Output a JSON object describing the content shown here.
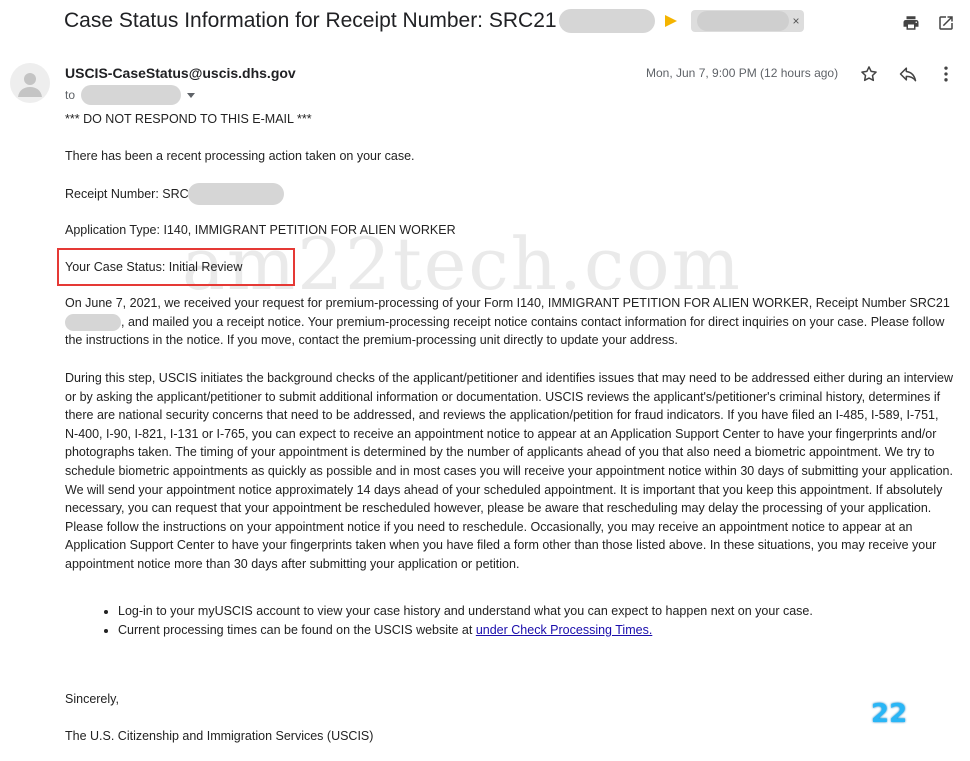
{
  "email": {
    "subject": "Case Status Information for Receipt Number: SRC21",
    "label_chip_close": "×",
    "sender": "USCIS-CaseStatus@uscis.dhs.gov",
    "to_label": "to",
    "date": "Mon, Jun 7, 9:00 PM (12 hours ago)"
  },
  "body": {
    "do_not_respond": "*** DO NOT RESPOND TO THIS E-MAIL ***",
    "recent_action": "There has been a recent processing action taken on your case.",
    "receipt_prefix": "Receipt Number: SRC",
    "application_type": "Application Type: I140, IMMIGRANT PETITION FOR ALIEN WORKER",
    "case_status": "Your Case Status: Initial Review",
    "para1_a": "On June 7, 2021, we received your request for premium-processing of your Form I140, IMMIGRANT PETITION FOR ALIEN WORKER, Receipt Number SRC21",
    "para1_b": ", and mailed you a receipt notice. Your premium-processing receipt notice contains contact information for direct inquiries on your case. Please follow the instructions in the notice. If you move, contact the premium-processing unit directly to update your address.",
    "para2": "During this step, USCIS initiates the background checks of the applicant/petitioner and identifies issues that may need to be addressed either during an interview or by asking the applicant/petitioner to submit additional information or documentation. USCIS reviews the applicant's/petitioner's criminal history, determines if there are national security concerns that need to be addressed, and reviews the application/petition for fraud indicators. If you have filed an I-485, I-589, I-751, N-400, I-90, I-821, I-131 or I-765, you can expect to receive an appointment notice to appear at an Application Support Center to have your fingerprints and/or photographs taken. The timing of your appointment is determined by the number of applicants ahead of you that also need a biometric appointment. We try to schedule biometric appointments as quickly as possible and in most cases you will receive your appointment notice within 30 days of submitting your application. We will send your appointment notice approximately 14 days ahead of your scheduled appointment. It is important that you keep this appointment. If absolutely necessary, you can request that your appointment be rescheduled however, please be aware that rescheduling may delay the processing of your application. Please follow the instructions on your appointment notice if you need to reschedule. Occasionally, you may receive an appointment notice to appear at an Application Support Center to have your fingerprints taken when you have filed a form other than those listed above. In these situations, you may receive your appointment notice more than 30 days after submitting your application or petition.",
    "bullet1": "Log-in to your myUSCIS account to view your case history and understand what you can expect to happen next on your case.",
    "bullet2_text": "Current processing times can be found on the USCIS website at ",
    "bullet2_link": "under Check Processing Times.",
    "sincerely": "Sincerely,",
    "signature": "The U.S. Citizenship and Immigration Services (USCIS)"
  },
  "watermark": "am22tech.com",
  "badge": "22",
  "colors": {
    "highlight_box": "#e53935",
    "link": "#1a0dab",
    "important_marker": "#f4b400",
    "badge": "#29b6f6"
  },
  "icons": [
    "print-icon",
    "popout-icon",
    "star-icon",
    "reply-icon",
    "more-vert-icon",
    "avatar-person-icon",
    "important-marker-icon",
    "chevron-down-icon"
  ]
}
